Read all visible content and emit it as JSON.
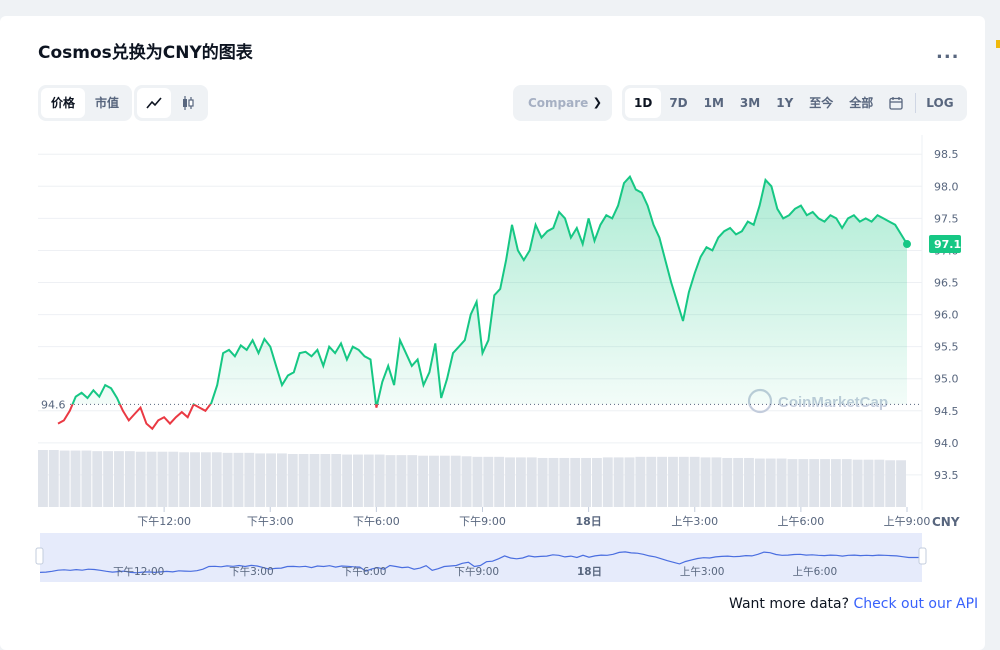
{
  "header": {
    "title": "Cosmos兑换为CNY的图表",
    "more_label": "..."
  },
  "toolbar": {
    "type_tabs": [
      "价格",
      "市值"
    ],
    "compare_placeholder": "Compare",
    "ranges": [
      "1D",
      "7D",
      "1M",
      "3M",
      "1Y",
      "至今",
      "全部"
    ],
    "log_label": "LOG",
    "active_type": "价格",
    "active_range": "1D"
  },
  "footer": {
    "text": "Want more data?",
    "link": "Check out our API"
  },
  "watermark": "CoinMarketCap",
  "colors": {
    "up": "#16c784",
    "down": "#ea3943",
    "accent": "#3861fb",
    "navigator": "#4a6ee0"
  },
  "chart_data": {
    "type": "line",
    "currency_label": "CNY",
    "open_price": 94.6,
    "open_price_label": "94.6",
    "last_price": 97.1,
    "last_price_label": "97.1",
    "ylim": [
      93.0,
      98.8
    ],
    "yticks": [
      93.5,
      94.0,
      94.5,
      95.0,
      95.5,
      96.0,
      96.5,
      97.0,
      97.5,
      98.0,
      98.5
    ],
    "ytick_labels": [
      "93.5",
      "94.0",
      "94.5",
      "95.0",
      "95.5",
      "96.0",
      "96.5",
      "97.0",
      "97.5",
      "98.0",
      "98.5"
    ],
    "xlim": [
      0,
      1440
    ],
    "xticks": [
      {
        "t": 180,
        "label": "下午12:00"
      },
      {
        "t": 360,
        "label": "下午3:00"
      },
      {
        "t": 540,
        "label": "下午6:00"
      },
      {
        "t": 720,
        "label": "下午9:00"
      },
      {
        "t": 900,
        "label": "18日"
      },
      {
        "t": 1080,
        "label": "上午3:00"
      },
      {
        "t": 1260,
        "label": "上午6:00"
      },
      {
        "t": 1440,
        "label": "上午9:00"
      }
    ],
    "nav_ticks": [
      "下午12:00",
      "下午3:00",
      "下午6:00",
      "下午9:00",
      "18日",
      "上午3:00",
      "上午6:00"
    ],
    "series": [
      {
        "values": [
          [
            0,
            94.3
          ],
          [
            10,
            94.35
          ],
          [
            20,
            94.5
          ],
          [
            30,
            94.72
          ],
          [
            40,
            94.78
          ],
          [
            50,
            94.7
          ],
          [
            60,
            94.82
          ],
          [
            70,
            94.72
          ],
          [
            80,
            94.9
          ],
          [
            90,
            94.85
          ],
          [
            100,
            94.7
          ],
          [
            110,
            94.5
          ],
          [
            120,
            94.35
          ],
          [
            130,
            94.45
          ],
          [
            140,
            94.55
          ],
          [
            150,
            94.3
          ],
          [
            160,
            94.22
          ],
          [
            170,
            94.35
          ],
          [
            180,
            94.4
          ],
          [
            190,
            94.3
          ],
          [
            200,
            94.4
          ],
          [
            210,
            94.48
          ],
          [
            220,
            94.4
          ],
          [
            230,
            94.6
          ],
          [
            240,
            94.55
          ],
          [
            250,
            94.5
          ],
          [
            260,
            94.62
          ],
          [
            270,
            94.9
          ],
          [
            280,
            95.4
          ],
          [
            290,
            95.45
          ],
          [
            300,
            95.35
          ],
          [
            310,
            95.52
          ],
          [
            320,
            95.45
          ],
          [
            330,
            95.6
          ],
          [
            340,
            95.4
          ],
          [
            350,
            95.62
          ],
          [
            360,
            95.5
          ],
          [
            370,
            95.2
          ],
          [
            380,
            94.9
          ],
          [
            390,
            95.05
          ],
          [
            400,
            95.1
          ],
          [
            410,
            95.4
          ],
          [
            420,
            95.42
          ],
          [
            430,
            95.35
          ],
          [
            440,
            95.45
          ],
          [
            450,
            95.2
          ],
          [
            460,
            95.5
          ],
          [
            470,
            95.4
          ],
          [
            480,
            95.55
          ],
          [
            490,
            95.3
          ],
          [
            500,
            95.5
          ],
          [
            510,
            95.45
          ],
          [
            520,
            95.35
          ],
          [
            530,
            95.3
          ],
          [
            540,
            94.55
          ],
          [
            550,
            94.95
          ],
          [
            560,
            95.2
          ],
          [
            570,
            94.9
          ],
          [
            580,
            95.6
          ],
          [
            590,
            95.4
          ],
          [
            600,
            95.2
          ],
          [
            610,
            95.3
          ],
          [
            620,
            94.9
          ],
          [
            630,
            95.1
          ],
          [
            640,
            95.55
          ],
          [
            650,
            94.7
          ],
          [
            660,
            95.0
          ],
          [
            670,
            95.4
          ],
          [
            680,
            95.5
          ],
          [
            690,
            95.6
          ],
          [
            700,
            96.0
          ],
          [
            710,
            96.2
          ],
          [
            720,
            95.4
          ],
          [
            730,
            95.6
          ],
          [
            740,
            96.3
          ],
          [
            750,
            96.4
          ],
          [
            760,
            96.85
          ],
          [
            770,
            97.4
          ],
          [
            780,
            97.0
          ],
          [
            790,
            96.85
          ],
          [
            800,
            97.0
          ],
          [
            810,
            97.4
          ],
          [
            820,
            97.2
          ],
          [
            830,
            97.3
          ],
          [
            840,
            97.35
          ],
          [
            850,
            97.6
          ],
          [
            860,
            97.5
          ],
          [
            870,
            97.2
          ],
          [
            880,
            97.35
          ],
          [
            890,
            97.1
          ],
          [
            900,
            97.5
          ],
          [
            910,
            97.15
          ],
          [
            920,
            97.4
          ],
          [
            930,
            97.55
          ],
          [
            940,
            97.5
          ],
          [
            950,
            97.7
          ],
          [
            960,
            98.05
          ],
          [
            970,
            98.15
          ],
          [
            980,
            97.95
          ],
          [
            990,
            97.9
          ],
          [
            1000,
            97.7
          ],
          [
            1010,
            97.4
          ],
          [
            1020,
            97.2
          ],
          [
            1030,
            96.85
          ],
          [
            1040,
            96.5
          ],
          [
            1050,
            96.2
          ],
          [
            1060,
            95.9
          ],
          [
            1070,
            96.35
          ],
          [
            1080,
            96.65
          ],
          [
            1090,
            96.9
          ],
          [
            1100,
            97.05
          ],
          [
            1110,
            97.0
          ],
          [
            1120,
            97.2
          ],
          [
            1130,
            97.3
          ],
          [
            1140,
            97.35
          ],
          [
            1150,
            97.25
          ],
          [
            1160,
            97.3
          ],
          [
            1170,
            97.45
          ],
          [
            1180,
            97.4
          ],
          [
            1190,
            97.7
          ],
          [
            1200,
            98.1
          ],
          [
            1210,
            98.0
          ],
          [
            1220,
            97.65
          ],
          [
            1230,
            97.5
          ],
          [
            1240,
            97.55
          ],
          [
            1250,
            97.65
          ],
          [
            1260,
            97.7
          ],
          [
            1270,
            97.55
          ],
          [
            1280,
            97.6
          ],
          [
            1290,
            97.5
          ],
          [
            1300,
            97.45
          ],
          [
            1310,
            97.55
          ],
          [
            1320,
            97.5
          ],
          [
            1330,
            97.35
          ],
          [
            1340,
            97.5
          ],
          [
            1350,
            97.55
          ],
          [
            1360,
            97.45
          ],
          [
            1370,
            97.5
          ],
          [
            1380,
            97.45
          ],
          [
            1390,
            97.55
          ],
          [
            1400,
            97.5
          ],
          [
            1410,
            97.45
          ],
          [
            1420,
            97.4
          ],
          [
            1430,
            97.25
          ],
          [
            1440,
            97.1
          ]
        ]
      }
    ],
    "volume": [
      1.0,
      1.0,
      0.99,
      0.99,
      0.99,
      0.98,
      0.98,
      0.98,
      0.98,
      0.97,
      0.97,
      0.97,
      0.97,
      0.96,
      0.96,
      0.96,
      0.96,
      0.95,
      0.95,
      0.95,
      0.94,
      0.94,
      0.94,
      0.93,
      0.93,
      0.93,
      0.93,
      0.93,
      0.92,
      0.92,
      0.92,
      0.92,
      0.91,
      0.91,
      0.91,
      0.9,
      0.9,
      0.9,
      0.9,
      0.89,
      0.88,
      0.88,
      0.88,
      0.87,
      0.87,
      0.87,
      0.86,
      0.86,
      0.86,
      0.86,
      0.86,
      0.86,
      0.87,
      0.87,
      0.87,
      0.88,
      0.88,
      0.88,
      0.88,
      0.88,
      0.88,
      0.87,
      0.87,
      0.86,
      0.86,
      0.86,
      0.85,
      0.85,
      0.85,
      0.84,
      0.84,
      0.84,
      0.84,
      0.84,
      0.84,
      0.83,
      0.83,
      0.83,
      0.82,
      0.82
    ],
    "grid": true,
    "legend": "none"
  }
}
